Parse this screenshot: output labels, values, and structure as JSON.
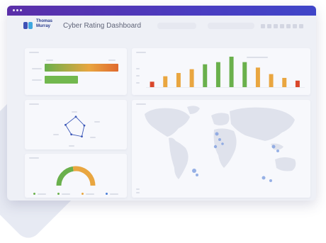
{
  "app": {
    "brand": "Thomas Murray",
    "title": "Cyber Rating Dashboard"
  },
  "colors": {
    "titlebar": "#4a35b8",
    "green": "#6ab04c",
    "orange": "#e58a3a",
    "red": "#d9472b",
    "amber": "#e9a640",
    "blue": "#4a7fd8"
  },
  "chart_data": [
    {
      "type": "bar",
      "orientation": "horizontal",
      "series": [
        {
          "values": [
            1.0,
            0.45
          ]
        }
      ],
      "colors_note": "gradient-green-to-orange, green"
    },
    {
      "type": "bar",
      "values": [
        1,
        2,
        2.6,
        3.3,
        4.2,
        4.6,
        5.6,
        4.6,
        3.6,
        2.4,
        1.7,
        1.2
      ],
      "colors": [
        "#d9472b",
        "#e9a640",
        "#e9a640",
        "#e9a640",
        "#6ab04c",
        "#6ab04c",
        "#6ab04c",
        "#6ab04c",
        "#e9a640",
        "#e9a640",
        "#e9a640",
        "#d9472b"
      ]
    },
    {
      "type": "radar",
      "values": [
        0.9,
        0.7,
        0.8,
        0.6,
        0.85
      ]
    },
    {
      "type": "gauge",
      "segments": [
        {
          "color": "#6ab04c",
          "value": 0.45
        },
        {
          "color": "#e9a640",
          "value": 0.55
        }
      ]
    }
  ]
}
